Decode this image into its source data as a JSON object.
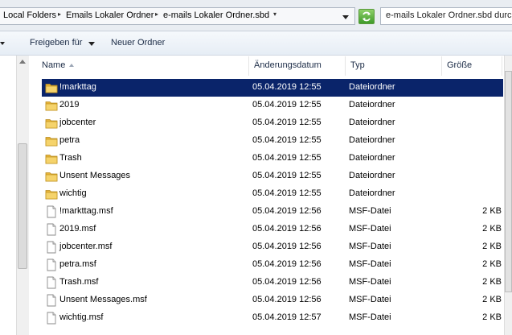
{
  "address_bar": {
    "breadcrumbs": [
      "Local Folders",
      "Emails Lokaler Ordner",
      "e-mails Lokaler Ordner.sbd"
    ],
    "search_field": "e-mails Lokaler Ordner.sbd durch"
  },
  "toolbar": {
    "share_label": "Freigeben für",
    "new_folder_label": "Neuer Ordner"
  },
  "columns": {
    "name": "Name",
    "date": "Änderungsdatum",
    "type": "Typ",
    "size": "Größe"
  },
  "files": [
    {
      "name": "!markttag",
      "date": "05.04.2019 12:55",
      "type": "Dateiordner",
      "size": "",
      "icon": "folder-icon",
      "selected": true
    },
    {
      "name": "2019",
      "date": "05.04.2019 12:55",
      "type": "Dateiordner",
      "size": "",
      "icon": "folder-icon"
    },
    {
      "name": "jobcenter",
      "date": "05.04.2019 12:55",
      "type": "Dateiordner",
      "size": "",
      "icon": "folder-icon"
    },
    {
      "name": "petra",
      "date": "05.04.2019 12:55",
      "type": "Dateiordner",
      "size": "",
      "icon": "folder-icon"
    },
    {
      "name": "Trash",
      "date": "05.04.2019 12:55",
      "type": "Dateiordner",
      "size": "",
      "icon": "folder-icon"
    },
    {
      "name": "Unsent Messages",
      "date": "05.04.2019 12:55",
      "type": "Dateiordner",
      "size": "",
      "icon": "folder-icon"
    },
    {
      "name": "wichtig",
      "date": "05.04.2019 12:55",
      "type": "Dateiordner",
      "size": "",
      "icon": "folder-icon"
    },
    {
      "name": "!markttag.msf",
      "date": "05.04.2019 12:56",
      "type": "MSF-Datei",
      "size": "2 KB",
      "icon": "file-icon"
    },
    {
      "name": "2019.msf",
      "date": "05.04.2019 12:56",
      "type": "MSF-Datei",
      "size": "2 KB",
      "icon": "file-icon"
    },
    {
      "name": "jobcenter.msf",
      "date": "05.04.2019 12:56",
      "type": "MSF-Datei",
      "size": "2 KB",
      "icon": "file-icon"
    },
    {
      "name": "petra.msf",
      "date": "05.04.2019 12:56",
      "type": "MSF-Datei",
      "size": "2 KB",
      "icon": "file-icon"
    },
    {
      "name": "Trash.msf",
      "date": "05.04.2019 12:56",
      "type": "MSF-Datei",
      "size": "2 KB",
      "icon": "file-icon"
    },
    {
      "name": "Unsent Messages.msf",
      "date": "05.04.2019 12:56",
      "type": "MSF-Datei",
      "size": "2 KB",
      "icon": "file-icon"
    },
    {
      "name": "wichtig.msf",
      "date": "05.04.2019 12:57",
      "type": "MSF-Datei",
      "size": "2 KB",
      "icon": "file-icon"
    }
  ],
  "colors": {
    "selection": "#0a246a",
    "folder": "#f2c744"
  }
}
